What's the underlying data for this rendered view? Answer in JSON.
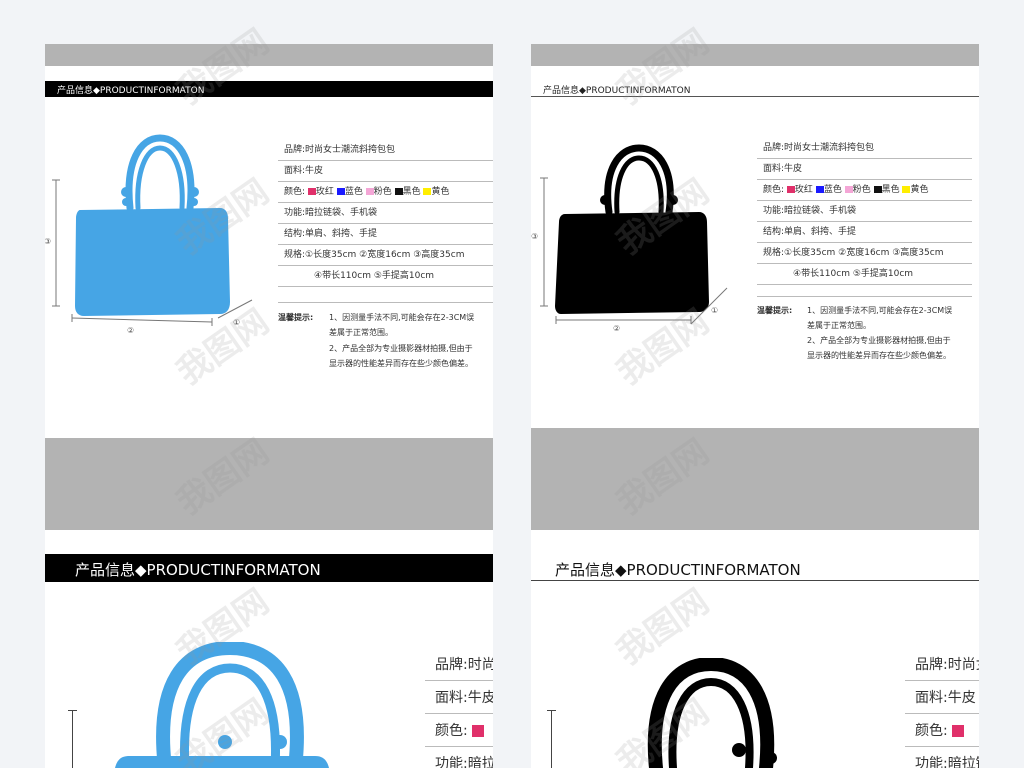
{
  "section_title": "产品信息◆PRODUCTINFORMATON",
  "specs": {
    "brand_label": "品牌:",
    "brand_value": "时尚女士潮流斜挎包包",
    "material_label": "面料:",
    "material_value": "牛皮",
    "color_label": "颜色:",
    "colors": [
      {
        "name": "玫红",
        "hex": "#e0306a"
      },
      {
        "name": "蓝色",
        "hex": "#1a1aff"
      },
      {
        "name": "粉色",
        "hex": "#f4a6d6"
      },
      {
        "name": "黑色",
        "hex": "#111111"
      },
      {
        "name": "黄色",
        "hex": "#ffee00"
      }
    ],
    "function_label": "功能:",
    "function_value": "暗拉链袋、手机袋",
    "structure_label": "结构:",
    "structure_value": "单肩、斜挎、手提",
    "size_label": "规格:",
    "size_line1": "①长度35cm ②宽度16cm ③高度35cm",
    "size_line2": "④带长110cm ⑤手提高10cm"
  },
  "tips": {
    "label": "温馨提示:",
    "line1a": "1、因测量手法不同,可能会存在2-3CM误",
    "line1b": "差属于正常范围。",
    "line2a": "2、产品全部为专业摄影器材拍摄,但由于",
    "line2b": "显示器的性能差异而存在些少颜色偏差。"
  },
  "dims": {
    "d1": "①",
    "d2": "②",
    "d3": "③"
  },
  "bag_colors": {
    "blue": "#46a5e5",
    "black": "#000000"
  },
  "watermark": "我图网"
}
